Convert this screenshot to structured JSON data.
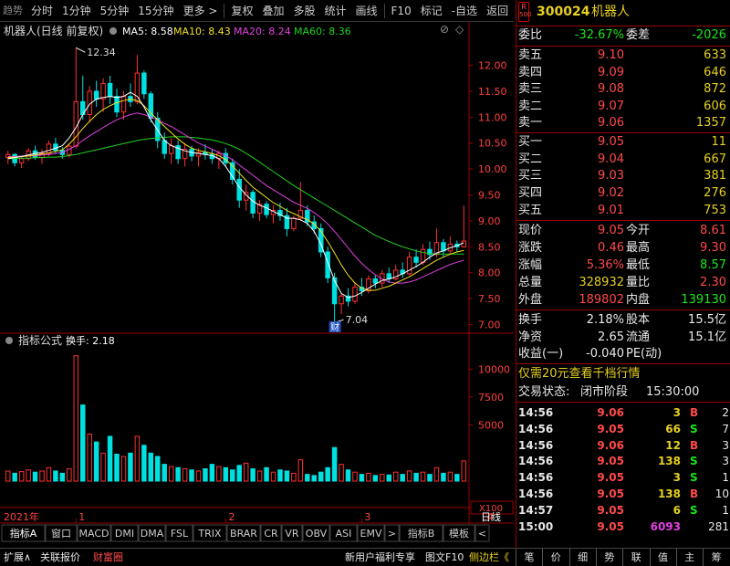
{
  "toolbar": {
    "logo": "趋势",
    "buttons": [
      "分时",
      "1分钟",
      "5分钟",
      "15分钟",
      "更多 >",
      "复权",
      "叠加",
      "多股",
      "统计",
      "画线",
      "F10",
      "标记",
      "-自选",
      "返回"
    ]
  },
  "stock": {
    "name": "机器人",
    "code": "300024",
    "badge_top": "R",
    "badge_bottom": "500"
  },
  "chart_header": {
    "title": "机器人(日线 前复权)",
    "ma5": "MA5: 8.58",
    "ma10": "MA10: 8.43",
    "ma20": "MA20: 8.24",
    "ma60": "MA60: 8.36"
  },
  "indicator_header": {
    "title": "指标公式",
    "value": "换手: 2.18"
  },
  "chart_data": [
    {
      "type": "candlestick",
      "price_ticks": [
        "12.00",
        "11.50",
        "11.00",
        "10.50",
        "10.00",
        "9.50",
        "9.00",
        "8.50",
        "8.00",
        "7.50",
        "7.00"
      ],
      "ylim": [
        6.85,
        12.45
      ],
      "annotations": {
        "high": "12.34",
        "low": "7.04",
        "event": "财"
      },
      "series": [
        {
          "name": "MA5",
          "color": "#ffffff"
        },
        {
          "name": "MA10",
          "color": "#f0e020"
        },
        {
          "name": "MA20",
          "color": "#e040e0"
        },
        {
          "name": "MA60",
          "color": "#20d020"
        }
      ],
      "x_labels": [
        "2021年",
        "1",
        "2",
        "3",
        "4",
        "5",
        "6"
      ],
      "period": "日线",
      "ohlc": [
        [
          10.22,
          10.35,
          10.1,
          10.28
        ],
        [
          10.28,
          10.3,
          10.05,
          10.12
        ],
        [
          10.12,
          10.25,
          10.02,
          10.2
        ],
        [
          10.2,
          10.4,
          10.15,
          10.35
        ],
        [
          10.35,
          10.45,
          10.18,
          10.22
        ],
        [
          10.22,
          10.38,
          10.1,
          10.3
        ],
        [
          10.3,
          10.55,
          10.25,
          10.48
        ],
        [
          10.48,
          10.6,
          10.3,
          10.36
        ],
        [
          10.36,
          10.42,
          10.2,
          10.28
        ],
        [
          10.28,
          10.5,
          10.22,
          10.44
        ],
        [
          10.44,
          12.34,
          10.4,
          11.3
        ],
        [
          11.3,
          11.8,
          10.95,
          11.05
        ],
        [
          11.05,
          11.6,
          10.9,
          11.5
        ],
        [
          11.5,
          11.7,
          11.2,
          11.35
        ],
        [
          11.35,
          11.75,
          11.1,
          11.65
        ],
        [
          11.65,
          11.8,
          11.25,
          11.4
        ],
        [
          11.4,
          11.55,
          11.0,
          11.1
        ],
        [
          11.1,
          11.5,
          10.95,
          11.4
        ],
        [
          11.4,
          11.65,
          11.2,
          11.3
        ],
        [
          11.3,
          12.2,
          11.25,
          11.85
        ],
        [
          11.85,
          11.9,
          11.35,
          11.45
        ],
        [
          11.45,
          11.5,
          10.9,
          10.98
        ],
        [
          10.98,
          11.1,
          10.4,
          10.55
        ],
        [
          10.55,
          10.7,
          10.2,
          10.3
        ],
        [
          10.3,
          10.6,
          10.1,
          10.45
        ],
        [
          10.45,
          10.55,
          10.1,
          10.2
        ],
        [
          10.2,
          10.5,
          10.05,
          10.38
        ],
        [
          10.38,
          10.45,
          10.15,
          10.25
        ],
        [
          10.25,
          10.4,
          10.05,
          10.32
        ],
        [
          10.32,
          10.48,
          10.18,
          10.28
        ],
        [
          10.28,
          10.38,
          10.1,
          10.2
        ],
        [
          10.2,
          10.35,
          10.0,
          10.3
        ],
        [
          10.3,
          10.4,
          10.05,
          10.12
        ],
        [
          10.12,
          10.2,
          9.7,
          9.8
        ],
        [
          9.8,
          10.0,
          9.25,
          9.4
        ],
        [
          9.4,
          9.7,
          9.2,
          9.55
        ],
        [
          9.55,
          9.6,
          9.05,
          9.15
        ],
        [
          9.15,
          9.4,
          9.0,
          9.32
        ],
        [
          9.32,
          9.38,
          9.05,
          9.12
        ],
        [
          9.12,
          9.3,
          8.95,
          9.2
        ],
        [
          9.2,
          9.35,
          9.0,
          9.1
        ],
        [
          9.1,
          9.25,
          8.7,
          8.85
        ],
        [
          8.85,
          9.1,
          8.8,
          9.05
        ],
        [
          9.05,
          9.75,
          9.0,
          9.2
        ],
        [
          9.2,
          9.3,
          8.9,
          8.98
        ],
        [
          8.98,
          9.1,
          8.75,
          8.85
        ],
        [
          8.85,
          8.95,
          8.3,
          8.4
        ],
        [
          8.4,
          8.5,
          7.8,
          7.9
        ],
        [
          7.9,
          8.0,
          7.04,
          7.4
        ],
        [
          7.4,
          7.6,
          7.2,
          7.55
        ],
        [
          7.55,
          7.7,
          7.35,
          7.45
        ],
        [
          7.45,
          7.8,
          7.4,
          7.72
        ],
        [
          7.72,
          7.9,
          7.55,
          7.65
        ],
        [
          7.65,
          7.95,
          7.6,
          7.88
        ],
        [
          7.88,
          7.95,
          7.7,
          7.8
        ],
        [
          7.8,
          8.05,
          7.72,
          7.98
        ],
        [
          7.98,
          8.1,
          7.8,
          7.88
        ],
        [
          7.88,
          8.15,
          7.85,
          8.05
        ],
        [
          8.05,
          8.2,
          7.9,
          7.98
        ],
        [
          7.98,
          8.4,
          7.95,
          8.3
        ],
        [
          8.3,
          8.45,
          8.1,
          8.2
        ],
        [
          8.2,
          8.55,
          8.15,
          8.45
        ],
        [
          8.45,
          8.6,
          8.25,
          8.35
        ],
        [
          8.35,
          8.85,
          8.3,
          8.58
        ],
        [
          8.58,
          8.65,
          8.3,
          8.42
        ],
        [
          8.42,
          8.7,
          8.35,
          8.55
        ],
        [
          8.55,
          8.62,
          8.4,
          8.5
        ],
        [
          8.5,
          9.3,
          8.48,
          8.61
        ]
      ],
      "ma5_line": [
        10.2,
        10.22,
        10.24,
        10.27,
        10.3,
        10.32,
        10.36,
        10.4,
        10.45,
        10.6,
        10.8,
        11.05,
        11.25,
        11.35,
        11.38,
        11.4,
        11.38,
        11.4,
        11.48,
        11.4,
        11.2,
        10.95,
        10.75,
        10.55,
        10.45,
        10.4,
        10.35,
        10.32,
        10.3,
        10.28,
        10.26,
        10.2,
        10.05,
        9.85,
        9.65,
        9.5,
        9.38,
        9.3,
        9.25,
        9.18,
        9.12,
        9.05,
        9.05,
        9.02,
        8.95,
        8.8,
        8.55,
        8.2,
        7.85,
        7.6,
        7.52,
        7.55,
        7.62,
        7.7,
        7.78,
        7.85,
        7.88,
        7.92,
        7.98,
        8.05,
        8.12,
        8.2,
        8.3,
        8.38,
        8.42,
        8.48,
        8.52,
        8.58
      ],
      "ma10_line": [
        10.22,
        10.23,
        10.24,
        10.25,
        10.27,
        10.29,
        10.31,
        10.34,
        10.37,
        10.48,
        10.62,
        10.78,
        10.92,
        11.05,
        11.15,
        11.22,
        11.28,
        11.32,
        11.35,
        11.32,
        11.22,
        11.08,
        10.95,
        10.82,
        10.7,
        10.58,
        10.48,
        10.4,
        10.36,
        10.33,
        10.3,
        10.26,
        10.18,
        10.06,
        9.92,
        9.78,
        9.65,
        9.55,
        9.45,
        9.35,
        9.28,
        9.2,
        9.14,
        9.08,
        9.02,
        8.94,
        8.8,
        8.6,
        8.38,
        8.15,
        7.95,
        7.8,
        7.7,
        7.66,
        7.66,
        7.7,
        7.74,
        7.8,
        7.86,
        7.92,
        8.0,
        8.08,
        8.16,
        8.24,
        8.3,
        8.36,
        8.4,
        8.43
      ],
      "ma20_line": [
        10.24,
        10.24,
        10.25,
        10.25,
        10.26,
        10.27,
        10.28,
        10.3,
        10.32,
        10.38,
        10.45,
        10.55,
        10.64,
        10.72,
        10.8,
        10.88,
        10.95,
        11.0,
        11.05,
        11.08,
        11.05,
        11.0,
        10.95,
        10.88,
        10.82,
        10.74,
        10.66,
        10.58,
        10.5,
        10.44,
        10.38,
        10.32,
        10.26,
        10.18,
        10.08,
        9.98,
        9.88,
        9.78,
        9.68,
        9.6,
        9.52,
        9.44,
        9.36,
        9.3,
        9.24,
        9.16,
        9.06,
        8.94,
        8.8,
        8.64,
        8.48,
        8.32,
        8.18,
        8.06,
        7.96,
        7.88,
        7.82,
        7.8,
        7.8,
        7.82,
        7.86,
        7.92,
        7.98,
        8.04,
        8.1,
        8.16,
        8.2,
        8.24
      ],
      "ma60_line": [
        10.2,
        10.2,
        10.21,
        10.21,
        10.22,
        10.22,
        10.23,
        10.23,
        10.24,
        10.26,
        10.28,
        10.31,
        10.34,
        10.37,
        10.4,
        10.43,
        10.46,
        10.49,
        10.52,
        10.55,
        10.57,
        10.59,
        10.6,
        10.61,
        10.62,
        10.62,
        10.62,
        10.61,
        10.6,
        10.58,
        10.56,
        10.53,
        10.49,
        10.44,
        10.38,
        10.3,
        10.22,
        10.13,
        10.04,
        9.95,
        9.86,
        9.77,
        9.68,
        9.6,
        9.52,
        9.44,
        9.36,
        9.28,
        9.2,
        9.12,
        9.04,
        8.96,
        8.88,
        8.8,
        8.72,
        8.66,
        8.6,
        8.55,
        8.5,
        8.46,
        8.42,
        8.39,
        8.37,
        8.36,
        8.36,
        8.36,
        8.36,
        8.36
      ]
    },
    {
      "type": "bar",
      "name": "换手",
      "y_ticks": [
        "10000",
        "7500",
        "5000"
      ],
      "ylim": [
        0,
        11500
      ],
      "unit": "X100",
      "values": [
        900,
        700,
        850,
        1000,
        800,
        900,
        1200,
        900,
        700,
        1100,
        11200,
        6800,
        4200,
        3500,
        2500,
        4000,
        2400,
        2200,
        2500,
        4000,
        3200,
        2500,
        2200,
        1500,
        1300,
        1200,
        1100,
        1000,
        900,
        1100,
        1500,
        1300,
        1200,
        1000,
        1400,
        1600,
        1100,
        900,
        1200,
        800,
        1000,
        900,
        700,
        1900,
        600,
        500,
        800,
        1200,
        3000,
        1500,
        1000,
        800,
        600,
        700,
        500,
        600,
        550,
        800,
        600,
        900,
        700,
        800,
        600,
        1200,
        700,
        800,
        600,
        1800
      ]
    }
  ],
  "indicator_tabs": [
    "指标A",
    "窗口",
    "MACD",
    "DMI",
    "DMA",
    "FSL",
    "TRIX",
    "BRAR",
    "CR",
    "VR",
    "OBV",
    "ASI",
    "EMV",
    ">",
    "指标B",
    "模板",
    "<"
  ],
  "bottom": {
    "left": [
      "扩展∧",
      "关联报价",
      "财富圈"
    ],
    "mid": [
      "新用户福利专享",
      "图文F10",
      "侧边栏《"
    ],
    "side_tabs": [
      "笔",
      "价",
      "细",
      "势",
      "联",
      "值",
      "主",
      "筹"
    ]
  },
  "quote": {
    "weibi_label": "委比",
    "weibi": "-32.67%",
    "weicha_label": "委差",
    "weicha": "-2026",
    "asks": [
      {
        "label": "卖五",
        "price": "9.10",
        "vol": "633"
      },
      {
        "label": "卖四",
        "price": "9.09",
        "vol": "646"
      },
      {
        "label": "卖三",
        "price": "9.08",
        "vol": "872"
      },
      {
        "label": "卖二",
        "price": "9.07",
        "vol": "606"
      },
      {
        "label": "卖一",
        "price": "9.06",
        "vol": "1357"
      }
    ],
    "bids": [
      {
        "label": "买一",
        "price": "9.05",
        "vol": "11"
      },
      {
        "label": "买二",
        "price": "9.04",
        "vol": "667"
      },
      {
        "label": "买三",
        "price": "9.03",
        "vol": "381"
      },
      {
        "label": "买四",
        "price": "9.02",
        "vol": "276"
      },
      {
        "label": "买五",
        "price": "9.01",
        "vol": "753"
      }
    ],
    "stats": [
      {
        "l1": "现价",
        "v1": "9.05",
        "c1": "red",
        "l2": "今开",
        "v2": "8.61",
        "c2": "red"
      },
      {
        "l1": "涨跌",
        "v1": "0.46",
        "c1": "red",
        "l2": "最高",
        "v2": "9.30",
        "c2": "red"
      },
      {
        "l1": "涨幅",
        "v1": "5.36%",
        "c1": "red",
        "l2": "最低",
        "v2": "8.57",
        "c2": "green"
      },
      {
        "l1": "总量",
        "v1": "328932",
        "c1": "yellow",
        "l2": "量比",
        "v2": "2.30",
        "c2": "red"
      },
      {
        "l1": "外盘",
        "v1": "189802",
        "c1": "red",
        "l2": "内盘",
        "v2": "139130",
        "c2": "green"
      }
    ],
    "stats2": [
      {
        "l1": "换手",
        "v1": "2.18%",
        "l2": "股本",
        "v2": "15.5亿"
      },
      {
        "l1": "净资",
        "v1": "2.65",
        "l2": "流通",
        "v2": "15.1亿"
      },
      {
        "l1": "收益(一)",
        "v1": "-0.040",
        "l2": "PE(动)",
        "v2": ""
      }
    ],
    "promo": "仅需20元查看千档行情",
    "trade_status_label": "交易状态:",
    "trade_status": "闭市阶段",
    "trade_time": "15:30:00",
    "ticks": [
      {
        "time": "14:56",
        "price": "9.06",
        "vol": "3",
        "side": "B",
        "num": "2"
      },
      {
        "time": "14:56",
        "price": "9.05",
        "vol": "66",
        "side": "S",
        "num": "7"
      },
      {
        "time": "14:56",
        "price": "9.06",
        "vol": "12",
        "side": "B",
        "num": "3"
      },
      {
        "time": "14:56",
        "price": "9.05",
        "vol": "138",
        "side": "S",
        "num": "3"
      },
      {
        "time": "14:56",
        "price": "9.05",
        "vol": "3",
        "side": "S",
        "num": "1"
      },
      {
        "time": "14:56",
        "price": "9.05",
        "vol": "138",
        "side": "B",
        "num": "10"
      },
      {
        "time": "14:57",
        "price": "9.05",
        "vol": "6",
        "side": "S",
        "num": "1"
      },
      {
        "time": "15:00",
        "price": "9.05",
        "vol": "6093",
        "side": "",
        "num": "281"
      }
    ]
  },
  "colors": {
    "up": "#ff3030",
    "down": "#00e0e0",
    "frame": "#990000"
  }
}
